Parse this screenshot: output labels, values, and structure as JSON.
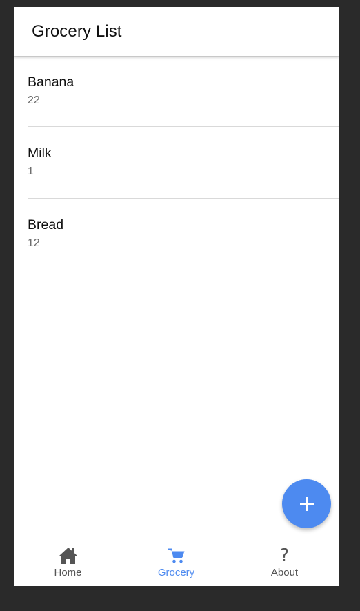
{
  "app_bar": {
    "title": "Grocery List"
  },
  "items": [
    {
      "name": "Banana",
      "quantity": "22"
    },
    {
      "name": "Milk",
      "quantity": "1"
    },
    {
      "name": "Bread",
      "quantity": "12"
    }
  ],
  "fab": {
    "icon": "plus-icon"
  },
  "tabs": [
    {
      "label": "Home",
      "icon": "home-icon",
      "active": false
    },
    {
      "label": "Grocery",
      "icon": "cart-icon",
      "active": true
    },
    {
      "label": "About",
      "icon": "question-icon",
      "active": false
    }
  ],
  "colors": {
    "accent": "#4d8af0",
    "tab_inactive": "#555555",
    "background": "#2a2a2a"
  }
}
